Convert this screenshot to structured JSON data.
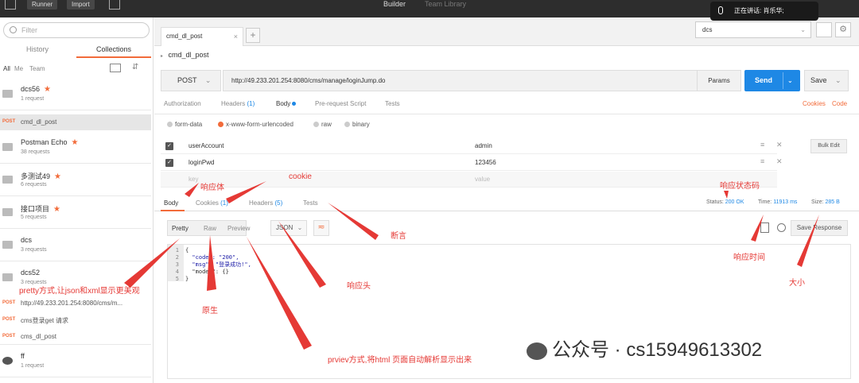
{
  "topbar": {
    "runner_label": "Runner",
    "import_label": "Import",
    "builder_label": "Builder",
    "team_library_label": "Team Library",
    "speaking_text": "正在讲话: 肖乐华;"
  },
  "sidebar": {
    "filter_placeholder": "Filter",
    "tab_history": "History",
    "tab_collections": "Collections",
    "sub_all": "All",
    "sub_me": "Me",
    "sub_team": "Team",
    "collections": [
      {
        "name": "dcs56",
        "count": "1 request",
        "starred": true
      },
      {
        "name": "Postman Echo",
        "count": "38 requests",
        "starred": true
      },
      {
        "name": "多测试49",
        "count": "6 requests",
        "starred": true
      },
      {
        "name": "接口项目",
        "count": "5 requests",
        "starred": true
      },
      {
        "name": "dcs",
        "count": "3 requests",
        "starred": false
      },
      {
        "name": "dcs52",
        "count": "3 requests",
        "starred": false
      },
      {
        "name": "ff",
        "count": "1 request",
        "starred": false
      }
    ],
    "star_glyph": "★",
    "requests": [
      {
        "method": "POST",
        "name": "cmd_dl_post"
      },
      {
        "method": "POST",
        "name": "http://49.233.201.254:8080/cms/m..."
      },
      {
        "method": "POST",
        "name": "cms登录get 请求"
      },
      {
        "method": "POST",
        "name": "cms_dl_post"
      }
    ]
  },
  "main": {
    "tab_label": "cmd_dl_post",
    "tab_close": "×",
    "add_tab": "+",
    "environment": "dcs",
    "request_name": "cmd_dl_post",
    "method": "POST",
    "url": "http://49.233.201.254:8080/cms/manage/loginJump.do",
    "params_label": "Params",
    "send_label": "Send",
    "save_label": "Save",
    "request_tabs": {
      "authorization": "Authorization",
      "headers": "Headers",
      "headers_count": "(1)",
      "body": "Body",
      "prerequest": "Pre-request Script",
      "tests": "Tests",
      "cookies": "Cookies",
      "code": "Code"
    },
    "body_types": [
      "form-data",
      "x-www-form-urlencoded",
      "raw",
      "binary"
    ],
    "form_rows": [
      {
        "key": "userAccount",
        "value": "admin"
      },
      {
        "key": "loginPwd",
        "value": "123456"
      }
    ],
    "key_placeholder": "key",
    "value_placeholder": "value",
    "bulk_edit_label": "Bulk Edit",
    "response_tabs": {
      "body": "Body",
      "cookies": "Cookies",
      "cookies_count": "(1)",
      "headers": "Headers",
      "headers_count": "(5)",
      "tests": "Tests"
    },
    "status_label": "Status:",
    "status_value": "200 OK",
    "time_label": "Time:",
    "time_value": "11913 ms",
    "size_label": "Size:",
    "size_value": "285 B",
    "view_modes": [
      "Pretty",
      "Raw",
      "Preview"
    ],
    "format": "JSON",
    "save_response_label": "Save Response",
    "code_lines": [
      {
        "n": "1",
        "text": "{"
      },
      {
        "n": "2",
        "text": "  \"code\": \"200\","
      },
      {
        "n": "3",
        "text": "  \"msg\": \"登录成功!\","
      },
      {
        "n": "4",
        "text": "  \"model\": {}"
      },
      {
        "n": "5",
        "text": "}"
      }
    ]
  },
  "annotations": {
    "response_body": "响应体",
    "cookie": "cookie",
    "status_code": "响应状态码",
    "assertion": "断言",
    "response_time": "响应时间",
    "size": "大小",
    "response_headers": "响应头",
    "pretty": "pretty方式,让json和xml显示更美观",
    "raw": "原生",
    "preview": "prviev方式,将html 页面自动解析显示出来"
  },
  "watermark": "公众号 · cs15949613302",
  "colors": {
    "accent": "#f26b3a",
    "primary": "#1e88e5",
    "annotation": "#e53935"
  }
}
